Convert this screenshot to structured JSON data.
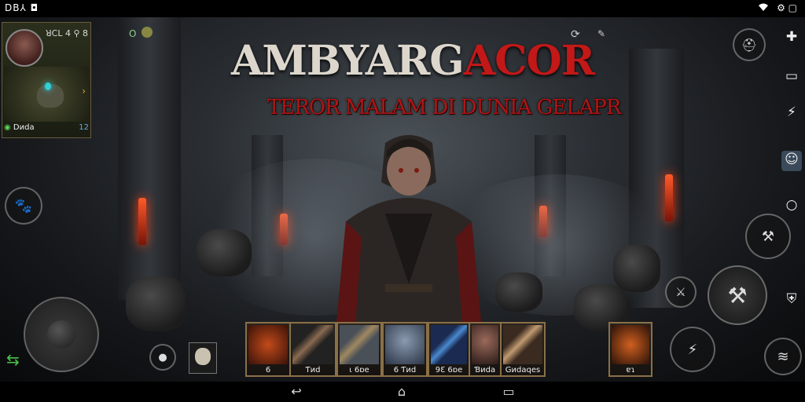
{
  "status_bar": {
    "left_text": "ꓓB⅄ ◘",
    "wifi": "wifi-icon",
    "right_text": "⚙ ▢"
  },
  "title": {
    "part1": "AMBYARG",
    "part2": "ACOR",
    "subtitle": "TEROR MALAM DI DUNIA GELAPR"
  },
  "player": {
    "info": "ꓤCL 4   ⚲ 8",
    "badge": "O",
    "panel_label": "Dᴎda",
    "minimap_badge": "12"
  },
  "skills": [
    {
      "label": "6"
    },
    {
      "label": "Ƭᴎd"
    },
    {
      "label": "ɩ 6ɒe"
    },
    {
      "label": "6 Ƭᴎd"
    },
    {
      "label": "9Ɛ 6ɒe"
    },
    {
      "label": "Ɓᴎda"
    },
    {
      "label": "Gᴎdaqes"
    }
  ],
  "item_slot_label": "ɐɿ",
  "colors": {
    "accent_red": "#c21818",
    "title_light": "#dcd6cc",
    "slot_border": "#8a7048"
  }
}
